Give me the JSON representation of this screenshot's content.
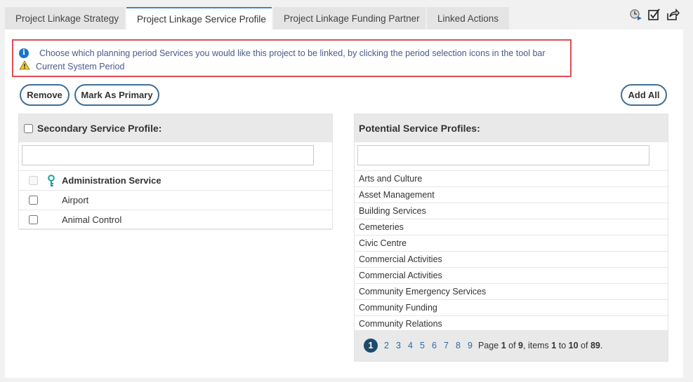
{
  "tabs": [
    {
      "label": "Project Linkage Strategy"
    },
    {
      "label": "Project Linkage Service Profile"
    },
    {
      "label": "Project Linkage Funding Partner"
    },
    {
      "label": "Linked Actions"
    }
  ],
  "active_tab": "Project Linkage Service Profile",
  "toolbar": {
    "icons": [
      "period-selection-icon",
      "checklist-icon",
      "share-icon"
    ]
  },
  "notice": {
    "info": "Choose which planning period Services you would like this project to be linked, by clicking the period selection icons in the tool bar",
    "warning": "Current System Period"
  },
  "buttons": {
    "remove": "Remove",
    "mark_primary": "Mark As Primary",
    "add_all": "Add All"
  },
  "secondary": {
    "title": "Secondary Service Profile:",
    "filter_value": "",
    "items": [
      {
        "label": "Administration Service",
        "primary": true,
        "checked": false,
        "disabled": true
      },
      {
        "label": "Airport",
        "primary": false,
        "checked": false,
        "disabled": false
      },
      {
        "label": "Animal Control",
        "primary": false,
        "checked": false,
        "disabled": false
      }
    ]
  },
  "potential": {
    "title": "Potential Service Profiles:",
    "filter_value": "",
    "items": [
      {
        "label": "Arts and Culture"
      },
      {
        "label": "Asset Management"
      },
      {
        "label": "Building Services"
      },
      {
        "label": "Cemeteries"
      },
      {
        "label": "Civic Centre"
      },
      {
        "label": "Commercial Activities"
      },
      {
        "label": "Commercial Activities"
      },
      {
        "label": "Community Emergency Services"
      },
      {
        "label": "Community Funding"
      },
      {
        "label": "Community Relations"
      }
    ],
    "pager": {
      "pages": [
        "1",
        "2",
        "3",
        "4",
        "5",
        "6",
        "7",
        "8",
        "9"
      ],
      "current": "1",
      "word_page": "Page",
      "page": "1",
      "word_of": "of",
      "total_pages": "9",
      "word_items": ", items",
      "from": "1",
      "word_to": "to",
      "to": "10",
      "total": "89"
    }
  },
  "colors": {
    "accent": "#3d85c6",
    "notice_border": "#e24b55",
    "button_border": "#3f6f95",
    "pager_current": "#1c4b6b"
  }
}
